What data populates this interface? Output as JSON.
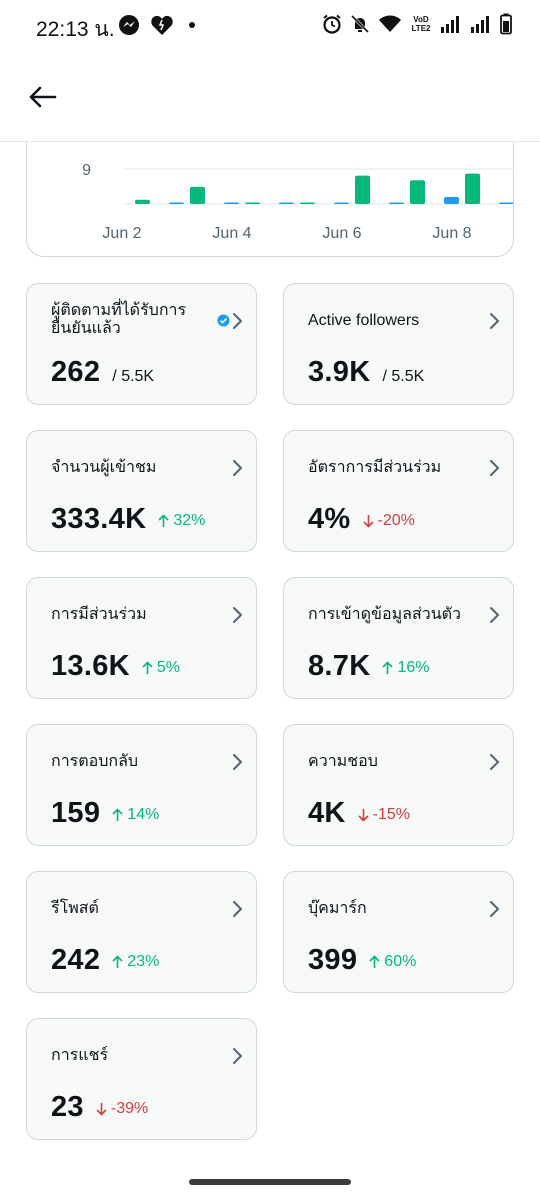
{
  "status_bar": {
    "time": "22:13 น.",
    "left_icons": [
      "messenger-icon",
      "heart-icon",
      "dot-icon"
    ],
    "right_icons": [
      "alarm-icon",
      "mute-icon",
      "wifi-icon",
      "volte-icon",
      "signal-icon",
      "signal-icon",
      "battery-icon"
    ],
    "volte_text": "VoD LTE2"
  },
  "header": {
    "back_icon": "arrow-left-icon"
  },
  "chart_data": {
    "type": "bar",
    "ytick_visible": "9",
    "x_tick_labels": [
      "Jun 2",
      "Jun 4",
      "Jun 6",
      "Jun 8"
    ],
    "series": [
      {
        "color": "#1d9bf0",
        "values": [
          0,
          0.4,
          0.4,
          0.4,
          0.4,
          0.4,
          1.8,
          0.4
        ]
      },
      {
        "color": "#00ba7c",
        "values": [
          1.1,
          4.4,
          0.4,
          0.4,
          7.3,
          6.1,
          7.8,
          4.3
        ]
      }
    ],
    "ylim": [
      0,
      9.5
    ],
    "grid": true
  },
  "tiles": [
    {
      "label": "ผู้ติดตามที่ได้รับการยืนยันแล้ว",
      "value": "262",
      "sub": "/ 5.5K",
      "verified": true
    },
    {
      "label": "Active followers",
      "value": "3.9K",
      "sub": "/ 5.5K"
    },
    {
      "label": "จำนวนผู้เข้าชม",
      "value": "333.4K",
      "trend": "32%",
      "dir": "up"
    },
    {
      "label": "อัตราการมีส่วนร่วม",
      "value": "4%",
      "trend": "-20%",
      "dir": "down"
    },
    {
      "label": "การมีส่วนร่วม",
      "value": "13.6K",
      "trend": "5%",
      "dir": "up"
    },
    {
      "label": "การเข้าดูข้อมูลส่วนตัว",
      "value": "8.7K",
      "trend": "16%",
      "dir": "up"
    },
    {
      "label": "การตอบกลับ",
      "value": "159",
      "trend": "14%",
      "dir": "up"
    },
    {
      "label": "ความชอบ",
      "value": "4K",
      "trend": "-15%",
      "dir": "down"
    },
    {
      "label": "รีโพสต์",
      "value": "242",
      "trend": "23%",
      "dir": "up"
    },
    {
      "label": "บุ๊คมาร์ก",
      "value": "399",
      "trend": "60%",
      "dir": "up"
    },
    {
      "label": "การแชร์",
      "value": "23",
      "trend": "-39%",
      "dir": "down"
    }
  ],
  "colors": {
    "up": "#00ba7c",
    "down": "#d83b3b",
    "accent": "#1d9bf0"
  }
}
